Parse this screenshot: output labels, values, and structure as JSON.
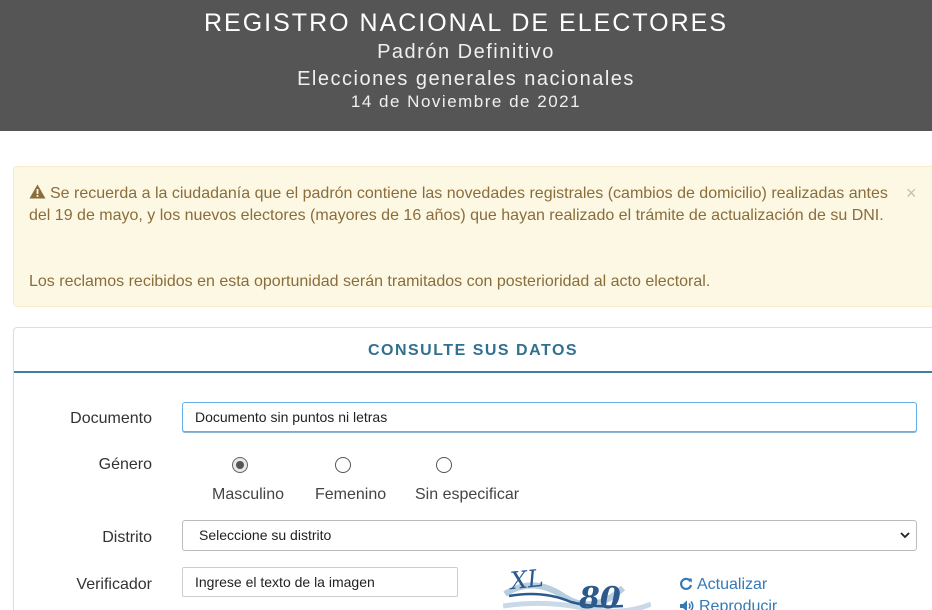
{
  "header": {
    "title": "REGISTRO NACIONAL DE ELECTORES",
    "subtitle": "Padrón Definitivo",
    "election": "Elecciones generales nacionales",
    "date": "14 de Noviembre de 2021"
  },
  "alert": {
    "icon": "warning-icon",
    "paragraph1": "Se recuerda a la ciudadanía que el padrón contiene las novedades registrales (cambios de domicilio) realizadas antes del 19 de mayo, y los nuevos electores (mayores de 16 años) que hayan realizado el trámite de actualización de su DNI.",
    "paragraph2": "Los reclamos recibidos en esta oportunidad serán tramitados con posterioridad al acto electoral.",
    "close_label": "×"
  },
  "form": {
    "heading": "CONSULTE SUS DATOS",
    "documento": {
      "label": "Documento",
      "value": "",
      "placeholder": "Documento sin puntos ni letras"
    },
    "genero": {
      "label": "Género",
      "options": [
        "Masculino",
        "Femenino",
        "Sin especificar"
      ],
      "selected": "Masculino"
    },
    "distrito": {
      "label": "Distrito",
      "selected": "Seleccione su distrito"
    },
    "verificador": {
      "label": "Verificador",
      "placeholder": "Ingrese el texto de la imagen",
      "captcha_text": "XL80",
      "refresh_label": "Actualizar",
      "refresh_icon": "refresh-icon",
      "audio_label": "Reproducir",
      "audio_icon": "volume-icon"
    }
  },
  "colors": {
    "header_bg": "#555555",
    "alert_bg": "#fcf8e3",
    "alert_text": "#8a6d3b",
    "panel_title": "#31708f",
    "link": "#337ab7"
  }
}
